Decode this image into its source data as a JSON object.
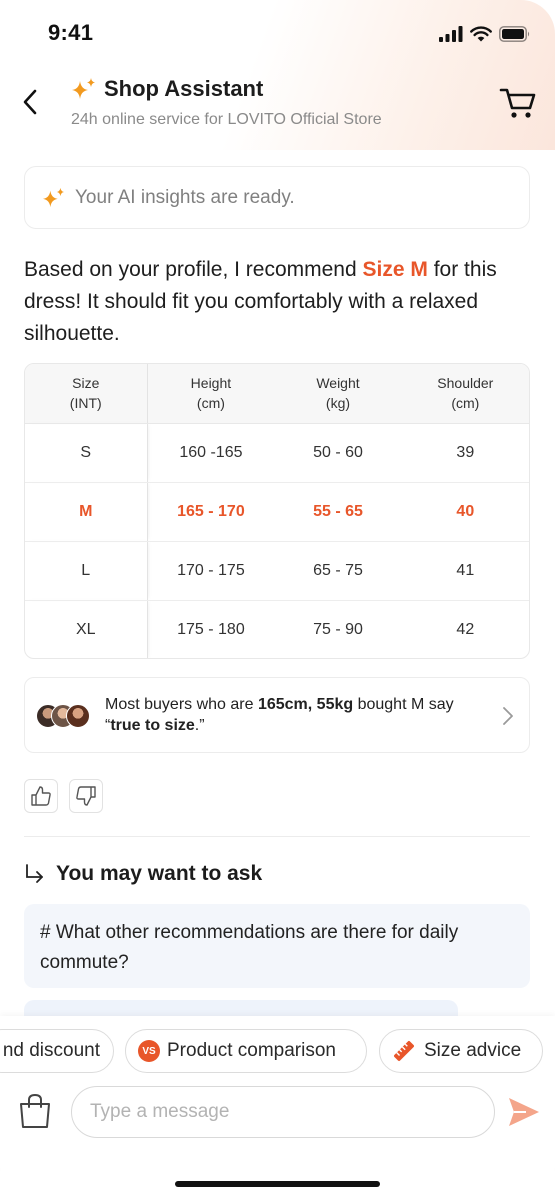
{
  "status_bar": {
    "time": "9:41"
  },
  "header": {
    "title": "Shop Assistant",
    "subtitle": "24h online service for LOVITO Official Store"
  },
  "insight": {
    "text": "Your AI insights are ready."
  },
  "recommendation": {
    "before": "Based on your profile, I recommend ",
    "highlight": "Size M",
    "after": " for this dress!  It should fit you comfortably with a relaxed silhouette."
  },
  "size_table": {
    "headers": [
      {
        "line1": "Size",
        "line2": "(INT)"
      },
      {
        "line1": "Height",
        "line2": "(cm)"
      },
      {
        "line1": "Weight",
        "line2": "(kg)"
      },
      {
        "line1": "Shoulder",
        "line2": "(cm)"
      }
    ],
    "rows": [
      [
        "S",
        "160 -165",
        "50 - 60",
        "39"
      ],
      [
        "M",
        "165 - 170",
        "55 - 65",
        "40"
      ],
      [
        "L",
        "170 - 175",
        "65 - 75",
        "41"
      ],
      [
        "XL",
        "175 - 180",
        "75 - 90",
        "42"
      ]
    ],
    "highlighted_row": "M"
  },
  "buyers": {
    "t1": "Most buyers who are ",
    "b1": "165cm, 55kg",
    "t2": " bought M say “",
    "b2": "true to size",
    "t3": ".”"
  },
  "ask": {
    "title": "You may want to ask",
    "question": "# What other recommendations are there for daily commute?"
  },
  "chips": [
    {
      "label": "nd discount"
    },
    {
      "label": "Product comparison",
      "badge": "VS"
    },
    {
      "label": "Size advice"
    }
  ],
  "composer": {
    "placeholder": "Type a message"
  },
  "colors": {
    "accent": "#e8562a",
    "star": "#f29a1f",
    "send": "#f4a58a"
  }
}
